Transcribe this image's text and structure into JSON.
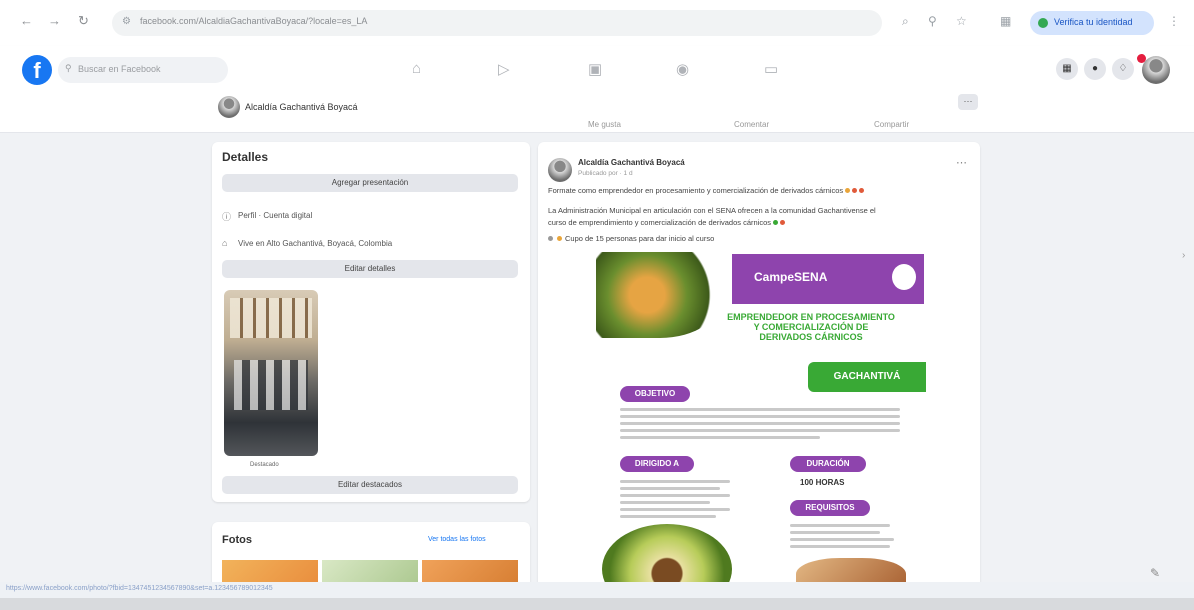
{
  "browser": {
    "back_icon": "back-arrow-icon",
    "forward_icon": "forward-arrow-icon",
    "reload_icon": "reload-icon",
    "url": "facebook.com/AlcaldiaGachantivaBoyaca/?locale=es_LA",
    "verify_label": "Verifica tu identidad"
  },
  "facebook": {
    "logo": "f",
    "search_placeholder": "Buscar en Facebook"
  },
  "page": {
    "name": "Alcaldía Gachantivá Boyacá",
    "tabs": [
      "Me gusta",
      "Comentar",
      "Compartir"
    ],
    "more_label": "···"
  },
  "details": {
    "title": "Detalles",
    "add_presentation": "Agregar presentación",
    "page_type": "Perfil · Cuenta digital",
    "location": "Vive en Alto Gachantivá, Boyacá, Colombia",
    "edit_details": "Editar detalles",
    "featured_label": "Destacado",
    "edit_featured": "Editar destacados"
  },
  "photos": {
    "title": "Fotos",
    "see_all": "Ver todas las fotos"
  },
  "post": {
    "author": "Alcaldía Gachantivá Boyacá",
    "meta": "Publicado por · 1 d",
    "line1": "Formate como emprendedor en procesamiento y comercialización de derivados cárnicos",
    "line2": "La Administración Municipal en articulación con el SENA ofrecen a la comunidad Gachantivense el",
    "line3": "curso de emprendimiento y comercialización de derivados cárnicos",
    "line4": "Cupo de 15 personas para dar inicio al curso",
    "flyer": {
      "brand": "CampeSENA",
      "title1": "EMPRENDEDOR EN PROCESAMIENTO",
      "title2": "Y COMERCIALIZACIÓN DE",
      "title3": "DERIVADOS CÁRNICOS",
      "town": "GACHANTIVÁ",
      "objetivo": "OBJETIVO",
      "dirigido": "DIRIGIDO A",
      "duracion": "DURACIÓN",
      "horas": "100 HORAS",
      "requisitos": "REQUISITOS"
    }
  },
  "colors": {
    "fb_blue": "#1877f2",
    "sena_purple": "#8e44ad",
    "sena_green": "#39a935",
    "notification_red": "#e41e3f"
  },
  "status_url": "https://www.facebook.com/photo/?fbid=1347451234567890&set=a.123456789012345"
}
